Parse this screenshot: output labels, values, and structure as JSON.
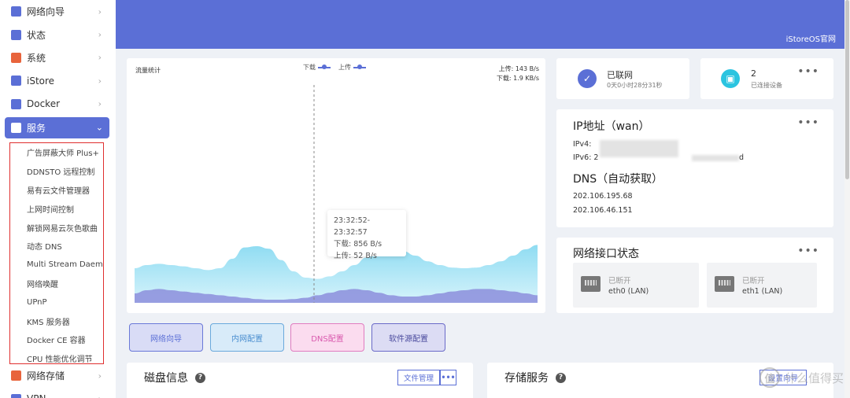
{
  "sidebar": {
    "items": [
      {
        "label": "网络向导",
        "icon": "cube-icon",
        "color": "#5b6fd6"
      },
      {
        "label": "状态",
        "icon": "grid-icon",
        "color": "#5b6fd6"
      },
      {
        "label": "系统",
        "icon": "gear-icon",
        "color": "#e8643c"
      },
      {
        "label": "iStore",
        "icon": "cube-icon",
        "color": "#5b6fd6"
      },
      {
        "label": "Docker",
        "icon": "whale-icon",
        "color": "#5b6fd6"
      },
      {
        "label": "服务",
        "icon": "services-icon",
        "color": "#ffffff"
      }
    ],
    "submenu": [
      "广告屏蔽大师 Plus+",
      "DDNSTO 远程控制",
      "易有云文件管理器",
      "上网时间控制",
      "解锁网易云灰色歌曲",
      "动态 DNS",
      "Multi Stream Daemon",
      "网络唤醒",
      "UPnP",
      "KMS 服务器",
      "Docker CE 容器",
      "CPU 性能优化调节"
    ],
    "bottom_items": [
      {
        "label": "网络存储",
        "icon": "storage-icon",
        "color": "#e8643c"
      },
      {
        "label": "VPN",
        "icon": "vpn-icon",
        "color": "#5b6fd6"
      }
    ]
  },
  "header": {
    "link": "iStoreOS官网",
    "accent": "#5b6fd6"
  },
  "traffic": {
    "title": "流量统计",
    "legend_down": "下载",
    "legend_up": "上传",
    "rate_up": "上传: 143 B/s",
    "rate_down": "下载: 1.9 KB/s",
    "tooltip_time": "23:32:52-23:32:57",
    "tooltip_down": "下载: 856 B/s",
    "tooltip_up": "上传: 52 B/s"
  },
  "status": {
    "online_label": "已联网",
    "online_time": "0天0小时28分31秒",
    "devices_count": "2",
    "devices_label": "已连接设备"
  },
  "ip": {
    "title": "IP地址（wan）",
    "ipv4_label": "IPv4:",
    "ipv6_label": "IPv6: 2",
    "ipv6_tail": "d",
    "dns_title": "DNS（自动获取）",
    "dns1": "202.106.195.68",
    "dns2": "202.106.46.151"
  },
  "interfaces": {
    "title": "网络接口状态",
    "ports": [
      {
        "status": "已断开",
        "name": "eth0 (LAN)"
      },
      {
        "status": "已断开",
        "name": "eth1 (LAN)"
      }
    ]
  },
  "quick": [
    {
      "label": "网络向导",
      "bg": "#d9dcf6",
      "border": "#6a78d8",
      "color": "#5b6fd6"
    },
    {
      "label": "内网配置",
      "bg": "#d8ebf9",
      "border": "#6aa9dc",
      "color": "#4b8fd0"
    },
    {
      "label": "DNS配置",
      "bg": "#fbdcef",
      "border": "#e07cc0",
      "color": "#d95aae"
    },
    {
      "label": "软件源配置",
      "bg": "#dcdcf4",
      "border": "#6a6ac8",
      "color": "#4b4b9e"
    }
  ],
  "disk": {
    "title": "磁盘信息",
    "file_btn": "文件管理",
    "more": "•••"
  },
  "storage": {
    "title": "存储服务",
    "btn": "设置向导"
  },
  "watermark": {
    "icon": "值",
    "text": "什么值得买"
  },
  "chart_data": {
    "type": "area",
    "title": "流量统计",
    "series": [
      {
        "name": "下载",
        "color": "#a5e3f4",
        "values": [
          0.55,
          0.6,
          0.62,
          0.6,
          0.58,
          0.55,
          0.52,
          0.55,
          0.7,
          0.88,
          0.9,
          0.86,
          0.68,
          0.5,
          0.4,
          0.38,
          0.42,
          0.5,
          0.6,
          0.72,
          0.82,
          0.86,
          0.82,
          0.75,
          0.66,
          0.6,
          0.56,
          0.55,
          0.56,
          0.6,
          0.66,
          0.75,
          0.85,
          0.92
        ]
      },
      {
        "name": "上传",
        "color": "#8c8edc",
        "values": [
          0.15,
          0.2,
          0.22,
          0.2,
          0.18,
          0.16,
          0.14,
          0.12,
          0.1,
          0.08,
          0.06,
          0.05,
          0.05,
          0.06,
          0.08,
          0.12,
          0.16,
          0.2,
          0.22,
          0.2,
          0.16,
          0.12,
          0.1,
          0.1,
          0.12,
          0.15,
          0.18,
          0.2,
          0.22,
          0.22,
          0.2,
          0.18,
          0.15,
          0.12
        ]
      }
    ]
  }
}
